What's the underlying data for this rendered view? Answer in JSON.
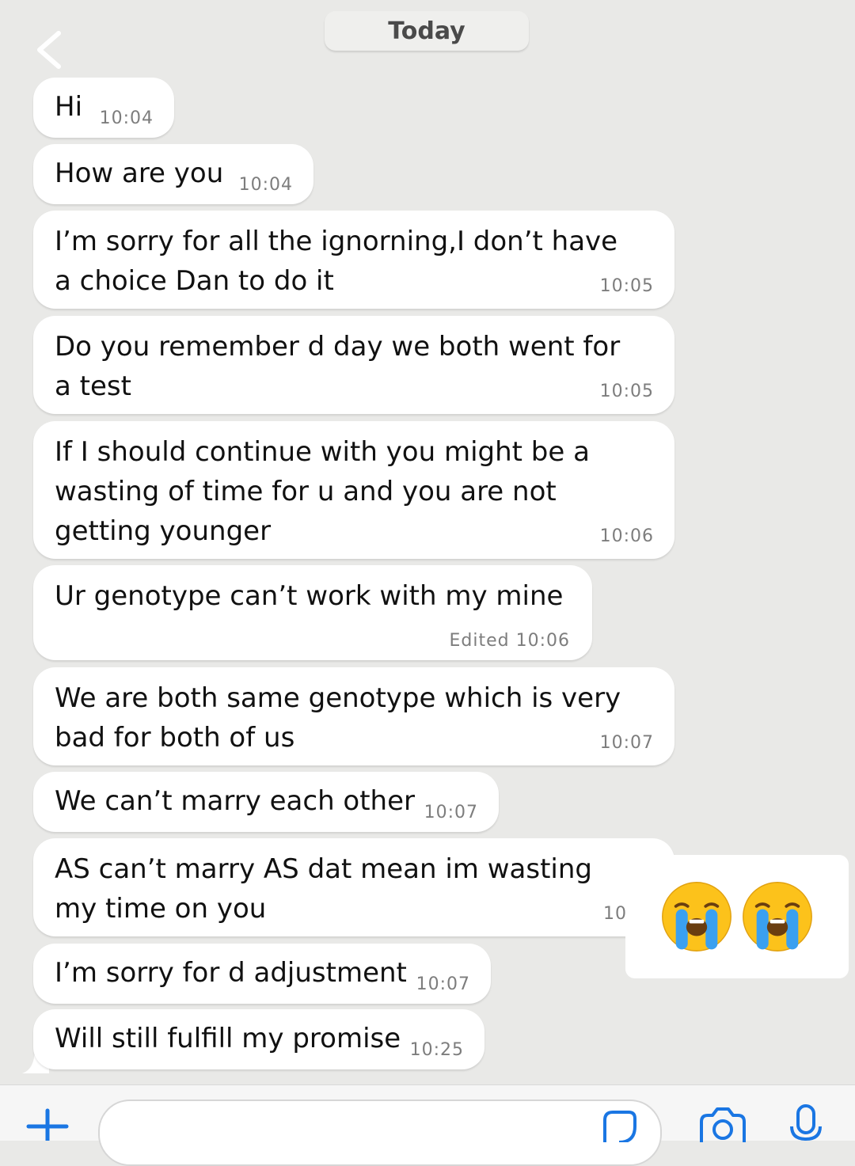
{
  "header": {
    "date_label": "Today"
  },
  "messages": [
    {
      "text": "Hi",
      "time": "10:04"
    },
    {
      "text": "How are you",
      "time": "10:04"
    },
    {
      "text": "I’m sorry for all the ignorning,I don’t have a choice Dan to do it",
      "time": "10:05"
    },
    {
      "text": "Do you remember d day we both went for a test",
      "time": "10:05"
    },
    {
      "text": "If I should continue with you might be a wasting of time for u and you are not getting younger",
      "time": "10:06"
    },
    {
      "text": "Ur genotype can’t work with my mine",
      "time": "Edited 10:06"
    },
    {
      "text": "We are both same genotype which is very bad for both of us",
      "time": "10:07"
    },
    {
      "text": "We can’t marry each other",
      "time": "10:07"
    },
    {
      "text": "AS can’t marry AS dat mean im wasting my time on you",
      "time": "10"
    },
    {
      "text": "I’m sorry for d adjustment",
      "time": "10:07"
    },
    {
      "text": "Will still fulfill my promise",
      "time": "10:25"
    }
  ],
  "overlay": {
    "emojis": [
      "loudly-crying-face",
      "loudly-crying-face"
    ]
  },
  "composer": {
    "icons": [
      "plus-icon",
      "sticker-icon",
      "camera-icon",
      "microphone-icon"
    ]
  },
  "colors": {
    "background": "#e9e9e7",
    "bubble": "#ffffff",
    "icon_blue": "#1a76e3"
  }
}
